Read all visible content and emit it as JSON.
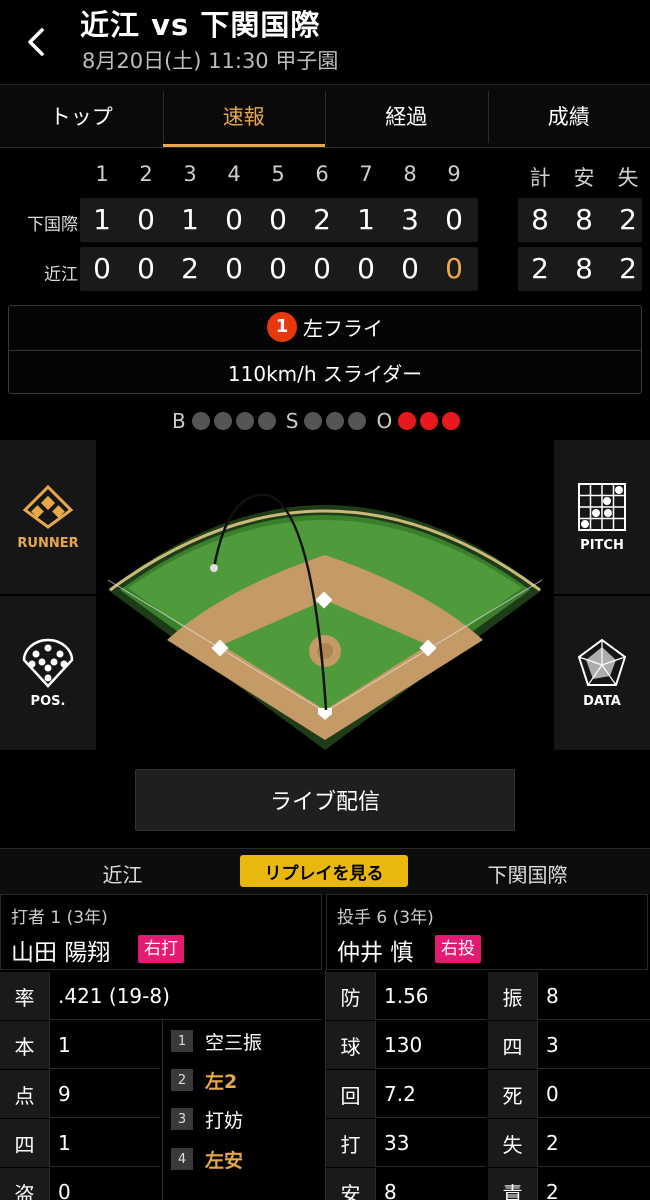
{
  "header": {
    "title": "近江 vs 下関国際",
    "subtitle": "8月20日(土) 11:30 甲子園"
  },
  "tabs": [
    {
      "label": "トップ",
      "active": false
    },
    {
      "label": "速報",
      "active": true
    },
    {
      "label": "経過",
      "active": false
    },
    {
      "label": "成績",
      "active": false
    }
  ],
  "scoreboard": {
    "innings": [
      "1",
      "2",
      "3",
      "4",
      "5",
      "6",
      "7",
      "8",
      "9"
    ],
    "totals_header": [
      "計",
      "安",
      "失"
    ],
    "teams": [
      {
        "name": "下国際",
        "scores": [
          "1",
          "0",
          "1",
          "0",
          "0",
          "2",
          "1",
          "3",
          "0"
        ],
        "totals": [
          "8",
          "8",
          "2"
        ]
      },
      {
        "name": "近江",
        "scores": [
          "0",
          "0",
          "2",
          "0",
          "0",
          "0",
          "0",
          "0",
          "0"
        ],
        "totals": [
          "2",
          "8",
          "2"
        ]
      }
    ]
  },
  "play": {
    "number": "1",
    "result": "左フライ",
    "pitch": "110km/h スライダー"
  },
  "count": {
    "b_label": "B",
    "s_label": "S",
    "o_label": "O",
    "balls": 0,
    "strikes": 0,
    "outs": 3
  },
  "side_buttons": {
    "runner": "RUNNER",
    "pos": "POS.",
    "pitch": "PITCH",
    "data": "DATA"
  },
  "live_button": "ライブ配信",
  "team_tabs": {
    "left": "近江",
    "replay": "リプレイを見る",
    "right": "下関国際"
  },
  "batter": {
    "meta": "打者 1 (3年)",
    "name": "山田 陽翔",
    "badge": "右打",
    "stats": [
      {
        "k": "率",
        "v": ".421 (19-8)"
      },
      {
        "k": "本",
        "v": "1"
      },
      {
        "k": "点",
        "v": "9"
      },
      {
        "k": "四",
        "v": "1"
      },
      {
        "k": "盗",
        "v": "0"
      }
    ],
    "history": [
      {
        "n": "1",
        "t": "空三振",
        "hit": false
      },
      {
        "n": "2",
        "t": "左2",
        "hit": true
      },
      {
        "n": "3",
        "t": "打妨",
        "hit": false
      },
      {
        "n": "4",
        "t": "左安",
        "hit": true
      }
    ]
  },
  "pitcher": {
    "meta": "投手 6 (3年)",
    "name": "仲井 慎",
    "badge": "右投",
    "stats_left": [
      {
        "k": "防",
        "v": "1.56"
      },
      {
        "k": "球",
        "v": "130"
      },
      {
        "k": "回",
        "v": "7.2"
      },
      {
        "k": "打",
        "v": "33"
      },
      {
        "k": "安",
        "v": "8"
      }
    ],
    "stats_right": [
      {
        "k": "振",
        "v": "8"
      },
      {
        "k": "四",
        "v": "3"
      },
      {
        "k": "死",
        "v": "0"
      },
      {
        "k": "失",
        "v": "2"
      },
      {
        "k": "責",
        "v": "2"
      }
    ]
  }
}
